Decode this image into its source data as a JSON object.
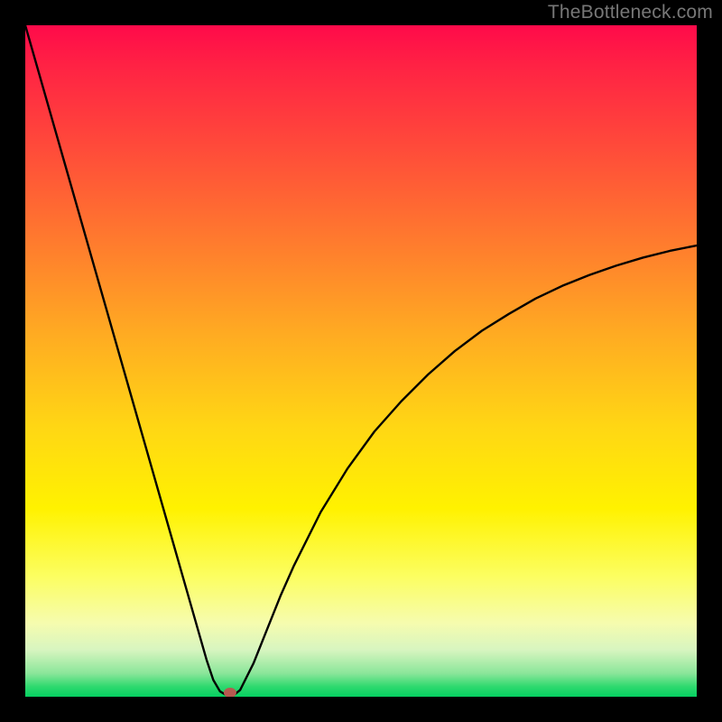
{
  "watermark": "TheBottleneck.com",
  "chart_data": {
    "type": "line",
    "title": "",
    "xlabel": "",
    "ylabel": "",
    "xlim": [
      0,
      100
    ],
    "ylim": [
      0,
      100
    ],
    "x": [
      0,
      2,
      4,
      6,
      8,
      10,
      12,
      14,
      16,
      18,
      20,
      22,
      24,
      26,
      27,
      28,
      29,
      30,
      31,
      32,
      34,
      36,
      38,
      40,
      44,
      48,
      52,
      56,
      60,
      64,
      68,
      72,
      76,
      80,
      84,
      88,
      92,
      96,
      100
    ],
    "values": [
      100,
      93,
      86,
      79,
      72,
      65,
      58,
      51,
      44,
      37,
      30,
      23,
      16,
      9,
      5.5,
      2.5,
      0.8,
      0.2,
      0.2,
      1.0,
      5,
      10,
      15,
      19.5,
      27.5,
      34,
      39.5,
      44,
      48,
      51.5,
      54.5,
      57,
      59.3,
      61.2,
      62.8,
      64.2,
      65.4,
      66.4,
      67.2
    ],
    "marker": {
      "x": 30.5,
      "y": 0.6
    },
    "grid": false,
    "legend": false
  },
  "colors": {
    "curve": "#000000",
    "marker_fill": "#b55a50",
    "frame": "#000000"
  }
}
